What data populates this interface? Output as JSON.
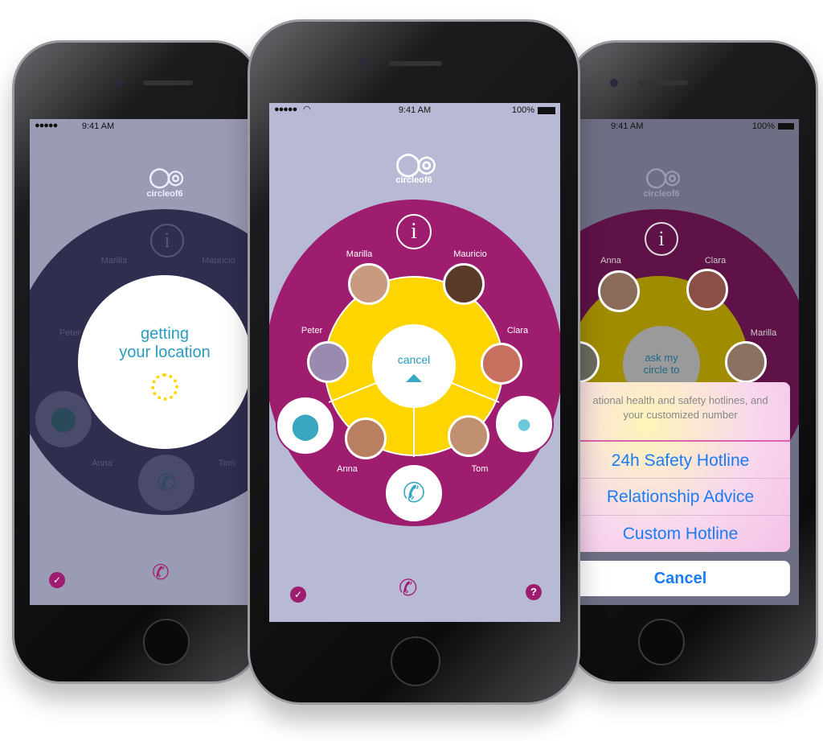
{
  "status_bar": {
    "signal": "●●●●●",
    "time": "9:41 AM",
    "battery": "100%"
  },
  "logo": {
    "text": "circleof6"
  },
  "left_phone": {
    "loading_text_line1": "getting",
    "loading_text_line2": "your location",
    "contacts": [
      "Marilla",
      "Mauricio",
      "Peter",
      "Anna",
      "Tom"
    ]
  },
  "center_phone": {
    "cancel_label": "cancel",
    "contacts": [
      {
        "name": "Marilla",
        "skin": "#c89a80"
      },
      {
        "name": "Mauricio",
        "skin": "#5a3a28"
      },
      {
        "name": "Peter",
        "skin": "#9a8ab0"
      },
      {
        "name": "Clara",
        "skin": "#c87060"
      },
      {
        "name": "Anna",
        "skin": "#b88060"
      },
      {
        "name": "Tom",
        "skin": "#c09070"
      }
    ],
    "actions": [
      "location-pin-icon",
      "phone-icon",
      "chat-bubble-icon"
    ]
  },
  "right_phone": {
    "center_label_line1": "ask my",
    "center_label_line2": "circle to",
    "contacts": [
      "Anna",
      "Clara",
      "Marilla"
    ],
    "sheet_message_line1": "ational health and safety hotlines, and",
    "sheet_message_line2": "your customized number",
    "sheet_options": [
      "24h Safety Hotline",
      "Relationship Advice",
      "Custom Hotline"
    ],
    "cancel_label": "Cancel"
  },
  "colors": {
    "magenta": "#9e1d6f",
    "yellow": "#ffd500",
    "teal": "#3aa7c0",
    "screen_bg": "#b8b9d4",
    "dark_circle": "#2f2e4f"
  }
}
